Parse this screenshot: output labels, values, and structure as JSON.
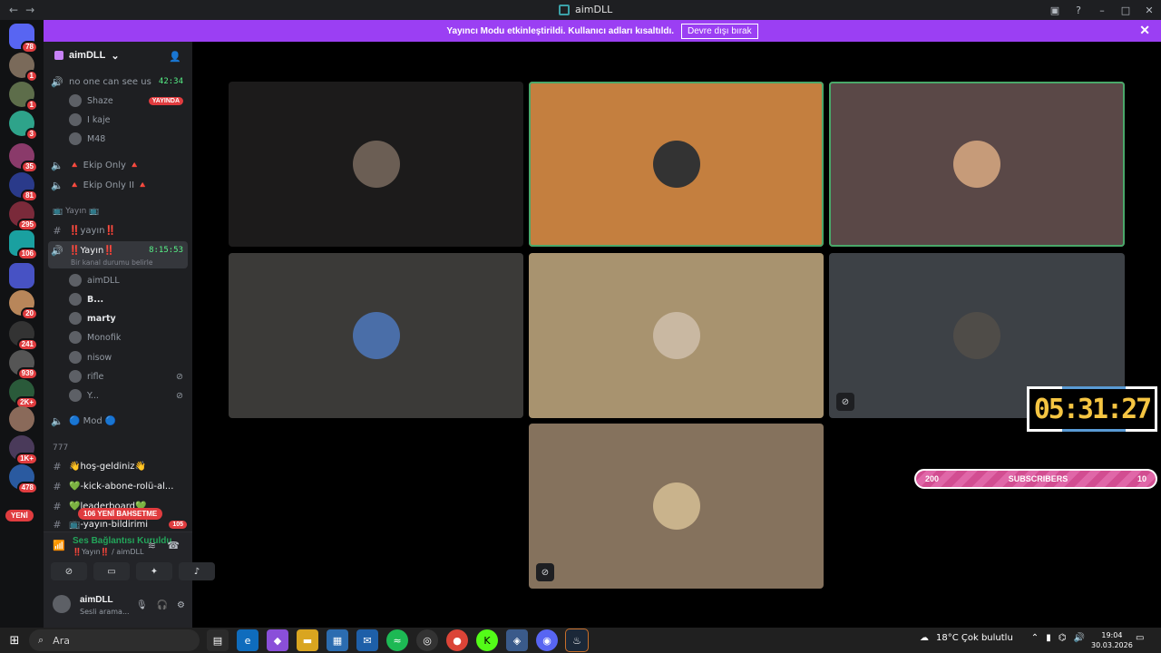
{
  "window": {
    "title": "aimDLL"
  },
  "banner": {
    "message": "Yayıncı Modu etkinleştirildi. Kullanıcı adları kısaltıldı.",
    "button": "Devre dışı bırak"
  },
  "rail": {
    "badges": [
      "78",
      "1",
      "1",
      "3",
      "35",
      "81",
      "295",
      "106",
      "20",
      "241",
      "939",
      "2K+",
      "1K+",
      "478"
    ],
    "new_label": "YENİ"
  },
  "server": {
    "name": "aimDLL"
  },
  "channels": {
    "vc1": {
      "name": "no one can see us",
      "time": "42:34"
    },
    "vc1_members": [
      "Shaze",
      "I kaje",
      "M48"
    ],
    "live_label": "YAYINDA",
    "vc2": "🔺 Ekip Only 🔺",
    "vc3": "🔺 Ekip Only II 🔺",
    "cat1": "📺 Yayın 📺",
    "text1": "‼️yayın‼️",
    "vc4": {
      "name": "‼️Yayın‼️",
      "time": "8:15:53",
      "status_hint": "Bir kanal durumu belirle"
    },
    "vc4_members": [
      "aimDLL",
      "B...",
      "marty",
      "Monofik",
      "nisow",
      "rifle",
      "Y..."
    ],
    "vc5": "🔵 Mod 🔵",
    "cat2": "777",
    "text2": "👋hoş-geldiniz👋",
    "text3": "💚-kick-abone-rolü-al...",
    "text4": "💚leaderboard💚",
    "text5": "📺-yayın-bildirimi",
    "text5_badge": "105",
    "mention_badge": "106 YENİ BAHSETME"
  },
  "voice_panel": {
    "status": "Ses Bağlantısı Kuruldu",
    "sub": "‼️Yayın‼️ / aimDLL"
  },
  "user": {
    "name": "aimDLL",
    "status": "Sesli arama..."
  },
  "tiles": [
    {
      "color": "#1c1b1b",
      "avatar": "#6b5e54",
      "speaking": false,
      "cam_off": false
    },
    {
      "color": "#c47f3f",
      "avatar": "#333",
      "speaking": true,
      "cam_off": false
    },
    {
      "color": "#5a4847",
      "avatar": "#c69b79",
      "speaking": true,
      "cam_off": false
    },
    {
      "color": "#3b3a38",
      "avatar": "#4a6ea8",
      "speaking": false,
      "cam_off": false
    },
    {
      "color": "#a8936f",
      "avatar": "#c9b8a2",
      "speaking": false,
      "cam_off": false
    },
    {
      "color": "#3d4146",
      "avatar": "#4f4c48",
      "speaking": false,
      "cam_off": true
    },
    {
      "color": "#85725d",
      "avatar": "#c9b38c",
      "speaking": false,
      "cam_off": true
    }
  ],
  "overlays": {
    "timer": "05:31:27",
    "subs_left": "200",
    "subs_label": "SUBSCRIBERS",
    "subs_right": "10"
  },
  "taskbar": {
    "search": "Ara",
    "weather": "18°C  Çok bulutlu",
    "time": "19:04",
    "date": "30.03.2026"
  }
}
